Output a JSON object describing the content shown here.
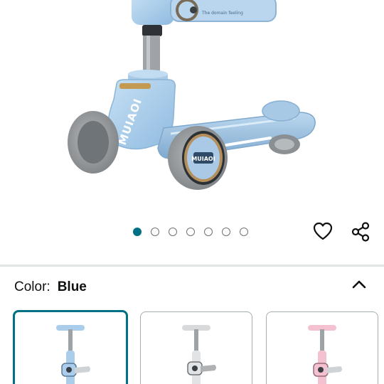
{
  "product": {
    "brand_mark": "MUIAOI",
    "tagline": "The domain feeling",
    "image_count": 7,
    "active_image": 1
  },
  "actions": {
    "wishlist_icon": "heart-icon",
    "share_icon": "share-icon"
  },
  "variation": {
    "label": "Color:",
    "selected": "Blue",
    "toggle_icon": "chevron-up-icon",
    "swatch_colors": [
      "Blue",
      "Grey",
      "Pink"
    ]
  },
  "colors": {
    "accent": "#007185",
    "scooter_blue": "#a9cdea",
    "scooter_grey": "#d7d9db",
    "scooter_pink": "#f3c1cf",
    "wheel_grey": "#8f9396"
  }
}
